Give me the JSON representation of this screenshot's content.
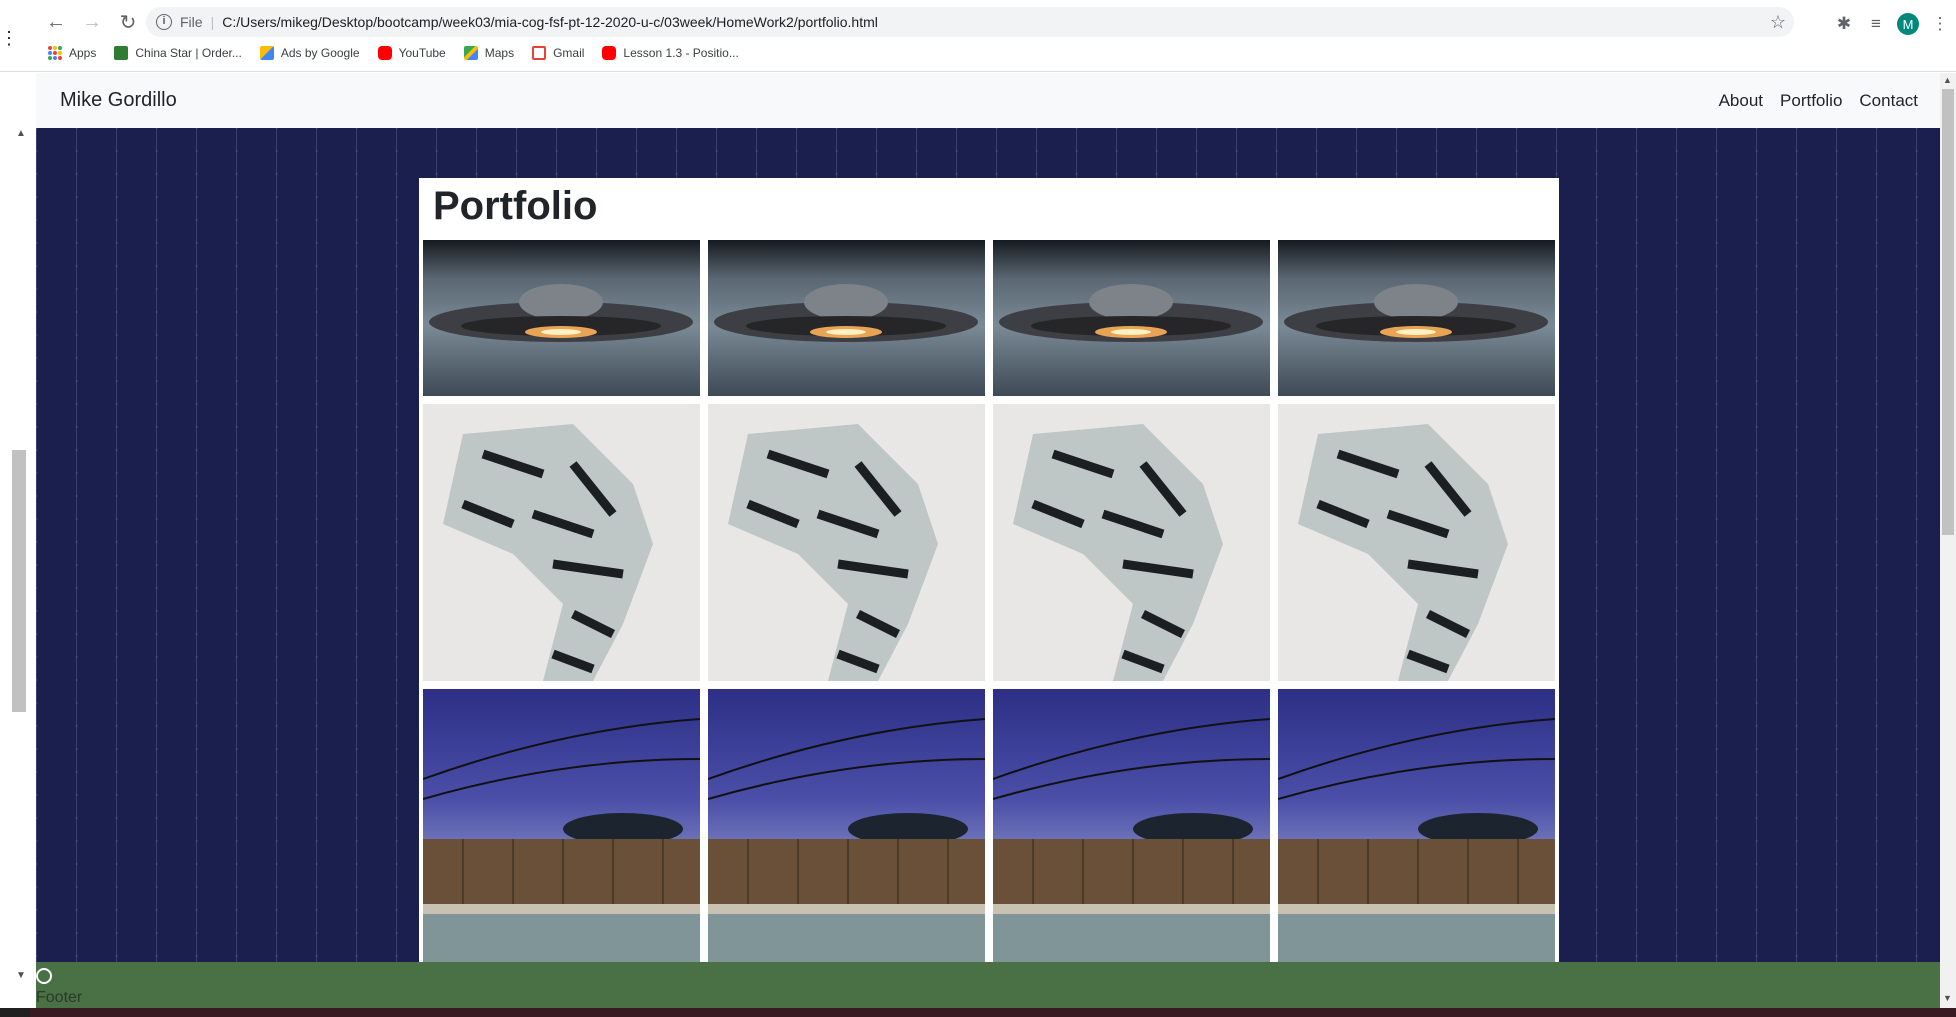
{
  "browser": {
    "scheme": "File",
    "url": "C:/Users/mikeg/Desktop/bootcamp/week03/mia-cog-fsf-pt-12-2020-u-c/03week/HomeWork2/portfolio.html",
    "avatar_letter": "M",
    "bookmarks": [
      {
        "label": "Apps",
        "icon": "apps-grid-icon"
      },
      {
        "label": "China Star | Order...",
        "icon": "china-star-icon",
        "color": "#2e7d32"
      },
      {
        "label": "Ads by Google",
        "icon": "google-ads-icon",
        "color": "#fbbc04"
      },
      {
        "label": "YouTube",
        "icon": "youtube-icon",
        "color": "#ff0000"
      },
      {
        "label": "Maps",
        "icon": "maps-icon",
        "color": "#34a853"
      },
      {
        "label": "Gmail",
        "icon": "gmail-icon",
        "color": "#ea4335"
      },
      {
        "label": "Lesson 1.3 - Positio...",
        "icon": "youtube-icon",
        "color": "#ff0000"
      }
    ]
  },
  "page": {
    "brand": "Mike Gordillo",
    "nav": [
      "About",
      "Portfolio",
      "Contact"
    ],
    "title": "Portfolio",
    "gallery_rows": [
      {
        "kind": "ufo",
        "count": 4
      },
      {
        "kind": "tiger",
        "count": 4
      },
      {
        "kind": "pool",
        "count": 4
      }
    ],
    "footer_icon": "github-icon",
    "footer_text": "Footer"
  },
  "colors": {
    "navbar_bg": "#f8f9fa",
    "pattern_bg": "#1b1f4d",
    "footer_bg": "#4a7046"
  }
}
